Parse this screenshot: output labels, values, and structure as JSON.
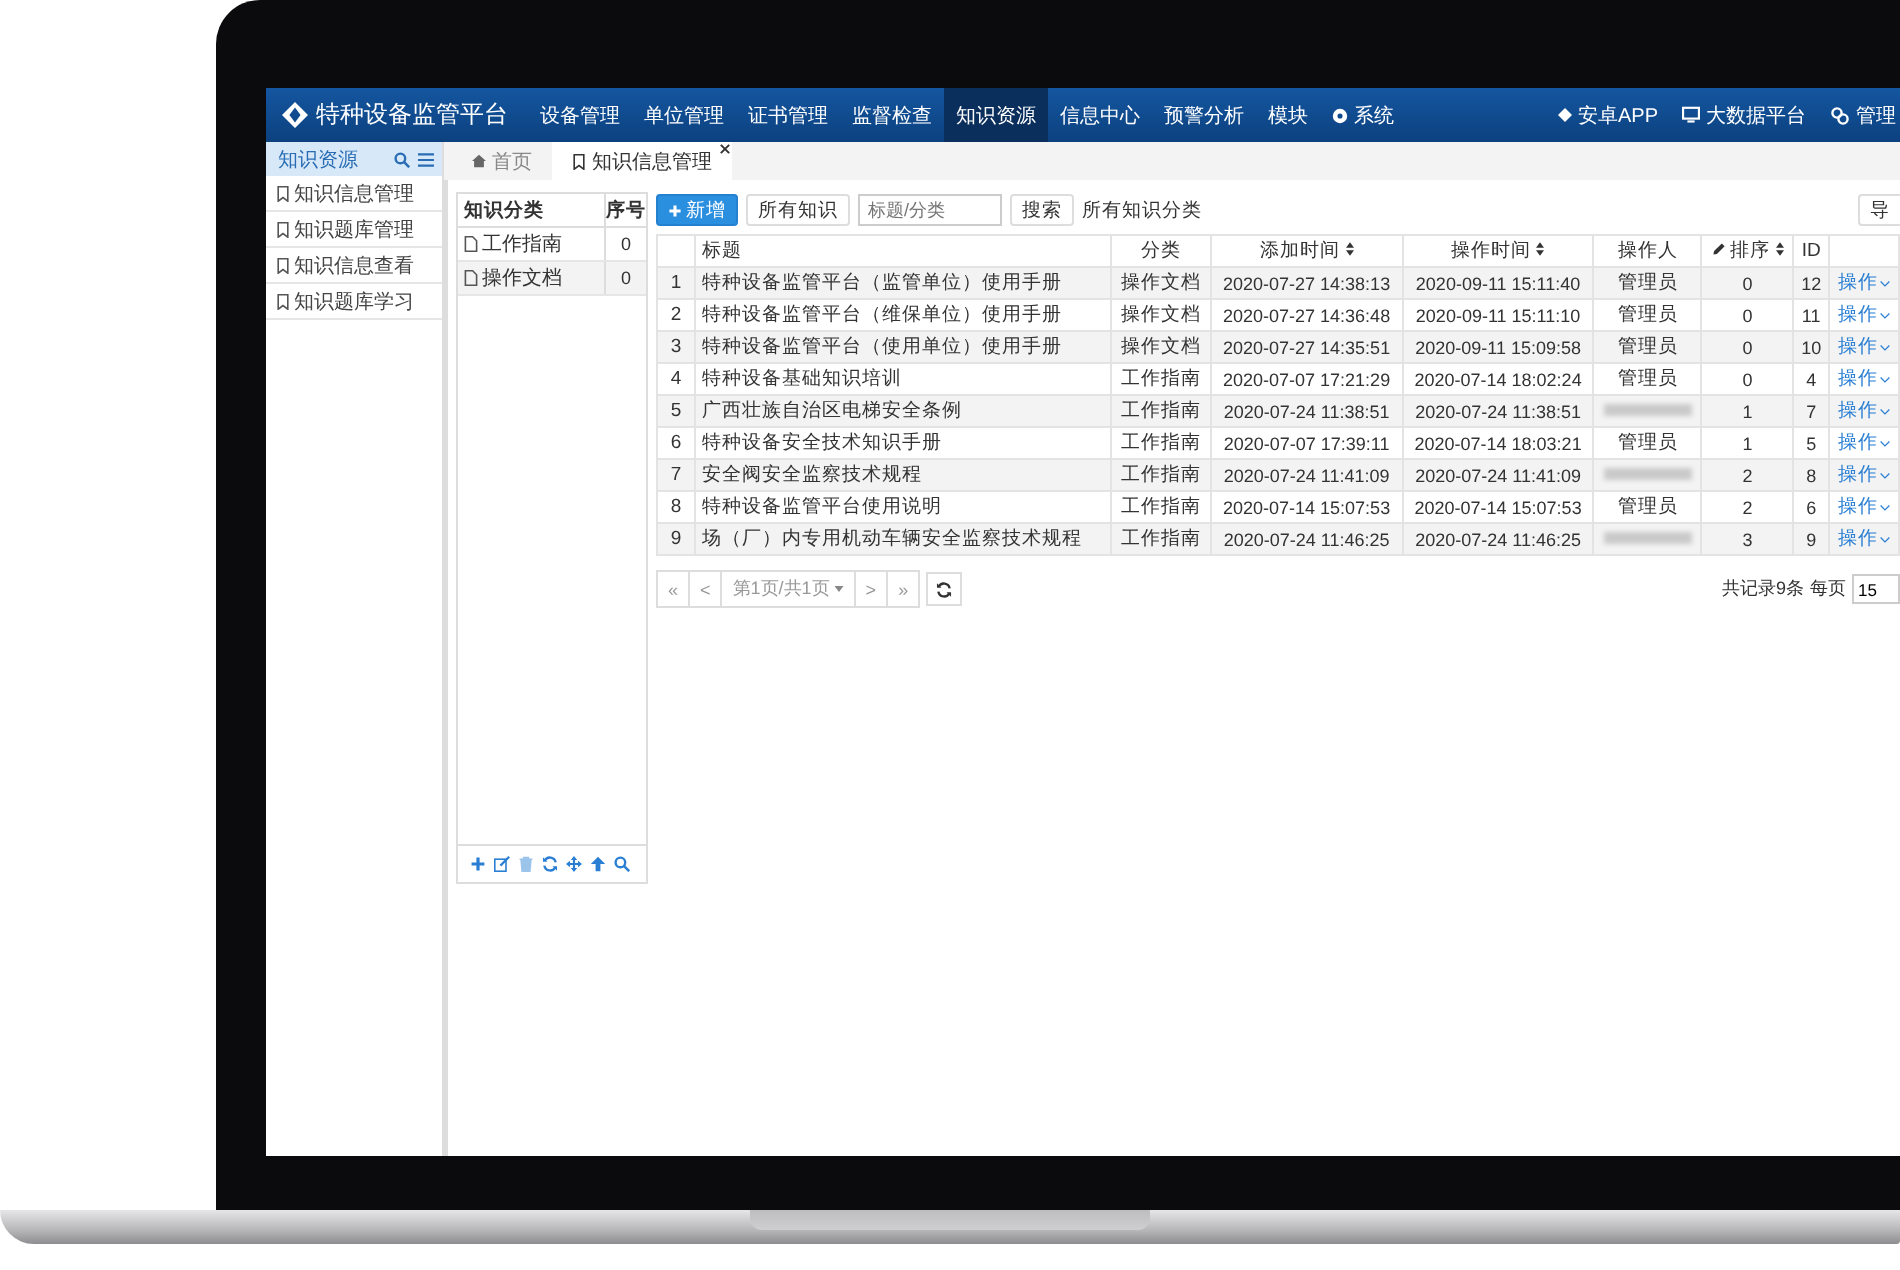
{
  "app": {
    "title": "特种设备监管平台"
  },
  "nav": {
    "items": [
      {
        "label": "设备管理",
        "selected": false
      },
      {
        "label": "单位管理",
        "selected": false
      },
      {
        "label": "证书管理",
        "selected": false
      },
      {
        "label": "监督检查",
        "selected": false
      },
      {
        "label": "知识资源",
        "selected": true
      },
      {
        "label": "信息中心",
        "selected": false
      },
      {
        "label": "预警分析",
        "selected": false
      },
      {
        "label": "模块",
        "selected": false
      }
    ],
    "system_menu": {
      "label": "系统",
      "selected": false
    },
    "app_link": "安卓APP",
    "bigdata_link": "大数据平台",
    "user_menu": "管理"
  },
  "sidebar": {
    "title": "知识资源",
    "items": [
      {
        "label": "知识信息管理"
      },
      {
        "label": "知识题库管理"
      },
      {
        "label": "知识信息查看"
      },
      {
        "label": "知识题库学习"
      }
    ]
  },
  "tabs": [
    {
      "label": "首页",
      "kind": "home",
      "selected": false
    },
    {
      "label": "知识信息管理",
      "kind": "page",
      "selected": true
    }
  ],
  "category_tree": {
    "columns": [
      "知识分类",
      "序号"
    ],
    "rows": [
      {
        "name": "工作指南",
        "order": "0"
      },
      {
        "name": "操作文档",
        "order": "0"
      }
    ]
  },
  "toolbar": {
    "add_button": "新增",
    "all_button": "所有知识",
    "search": {
      "placeholder": "标题/分类"
    },
    "search_button": "搜索",
    "filter_label": "所有知识分类",
    "export_button": "导"
  },
  "table": {
    "columns": [
      {
        "sortable": false,
        "editable": false
      },
      {
        "label": "标题",
        "sortable": false,
        "editable": false
      },
      {
        "label": "分类",
        "sortable": false,
        "editable": false
      },
      {
        "label": "添加时间",
        "sortable": true,
        "editable": false
      },
      {
        "label": "操作时间",
        "sortable": true,
        "editable": false
      },
      {
        "label": "操作人",
        "sortable": false,
        "editable": false
      },
      {
        "label": "排序",
        "sortable": true,
        "editable": true
      },
      {
        "label": "ID",
        "sortable": false,
        "editable": false
      },
      {
        "sortable": false,
        "editable": false
      }
    ],
    "rows": [
      {
        "index": "1",
        "title": "特种设备监管平台（监管单位）使用手册",
        "category": "操作文档",
        "added": "2020-07-27 14:38:13",
        "updated": "2020-09-11 15:11:40",
        "operator": "管理员",
        "operator_redacted": false,
        "sort": "0",
        "id": "12",
        "action": "操作"
      },
      {
        "index": "2",
        "title": "特种设备监管平台（维保单位）使用手册",
        "category": "操作文档",
        "added": "2020-07-27 14:36:48",
        "updated": "2020-09-11 15:11:10",
        "operator": "管理员",
        "operator_redacted": false,
        "sort": "0",
        "id": "11",
        "action": "操作"
      },
      {
        "index": "3",
        "title": "特种设备监管平台（使用单位）使用手册",
        "category": "操作文档",
        "added": "2020-07-27 14:35:51",
        "updated": "2020-09-11 15:09:58",
        "operator": "管理员",
        "operator_redacted": false,
        "sort": "0",
        "id": "10",
        "action": "操作"
      },
      {
        "index": "4",
        "title": "特种设备基础知识培训",
        "category": "工作指南",
        "added": "2020-07-07 17:21:29",
        "updated": "2020-07-14 18:02:24",
        "operator": "管理员",
        "operator_redacted": false,
        "sort": "0",
        "id": "4",
        "action": "操作"
      },
      {
        "index": "5",
        "title": "广西壮族自治区电梯安全条例",
        "category": "工作指南",
        "added": "2020-07-24 11:38:51",
        "updated": "2020-07-24 11:38:51",
        "operator_redacted": true,
        "sort": "1",
        "id": "7",
        "action": "操作"
      },
      {
        "index": "6",
        "title": "特种设备安全技术知识手册",
        "category": "工作指南",
        "added": "2020-07-07 17:39:11",
        "updated": "2020-07-14 18:03:21",
        "operator": "管理员",
        "operator_redacted": false,
        "sort": "1",
        "id": "5",
        "action": "操作"
      },
      {
        "index": "7",
        "title": "安全阀安全监察技术规程",
        "category": "工作指南",
        "added": "2020-07-24 11:41:09",
        "updated": "2020-07-24 11:41:09",
        "operator_redacted": true,
        "sort": "2",
        "id": "8",
        "action": "操作"
      },
      {
        "index": "8",
        "title": "特种设备监管平台使用说明",
        "category": "工作指南",
        "added": "2020-07-14 15:07:53",
        "updated": "2020-07-14 15:07:53",
        "operator": "管理员",
        "operator_redacted": false,
        "sort": "2",
        "id": "6",
        "action": "操作"
      },
      {
        "index": "9",
        "title": "场（厂）内专用机动车辆安全监察技术规程",
        "category": "工作指南",
        "added": "2020-07-24 11:46:25",
        "updated": "2020-07-24 11:46:25",
        "operator_redacted": true,
        "sort": "3",
        "id": "9",
        "action": "操作"
      }
    ]
  },
  "pagination": {
    "first": "«",
    "prev": "<",
    "page_label": "第1页/共1页",
    "next": ">",
    "last": "»",
    "total": "共记录9条",
    "per_page_label": "每页",
    "per_page": "15"
  }
}
